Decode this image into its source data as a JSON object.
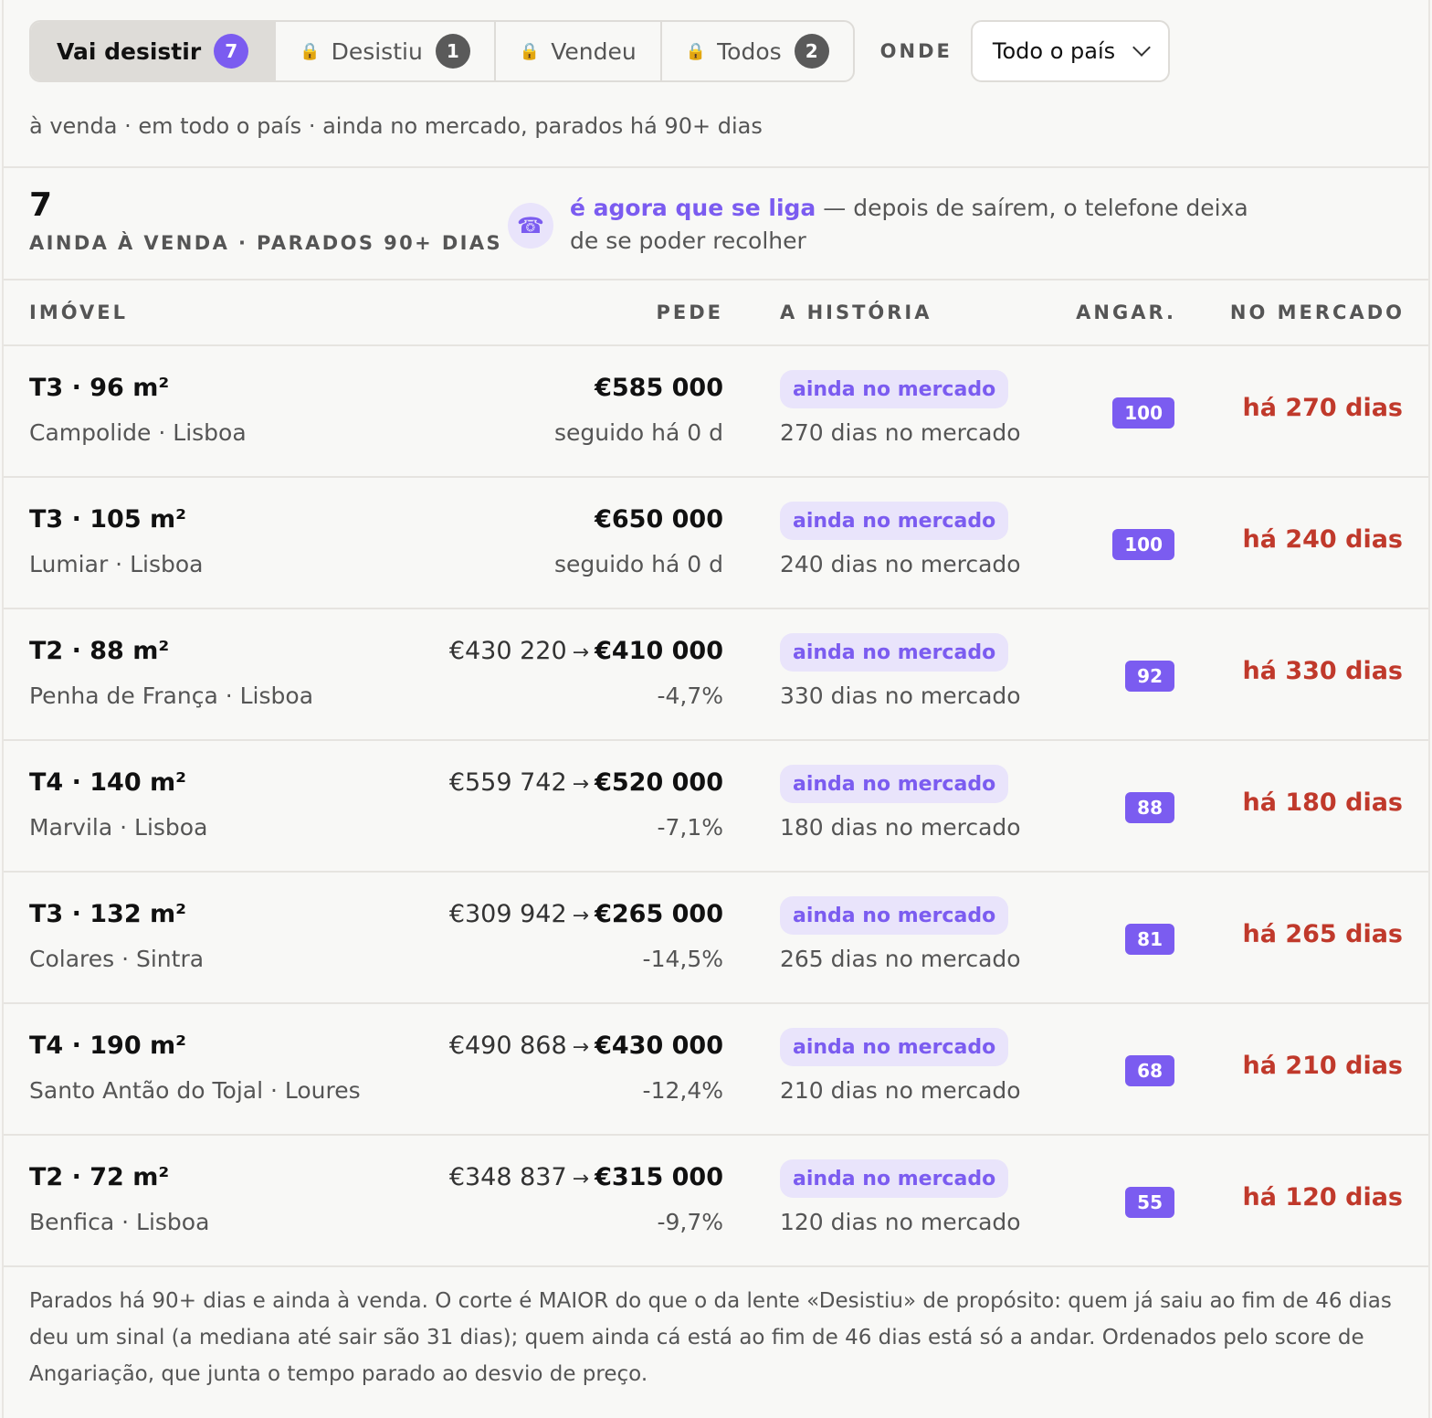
{
  "tabs": [
    {
      "label": "Vai desistir",
      "count": "7",
      "locked": false
    },
    {
      "label": "Desistiu",
      "count": "1",
      "locked": true
    },
    {
      "label": "Vendeu",
      "count": "",
      "locked": true
    },
    {
      "label": "Todos",
      "count": "2",
      "locked": true
    }
  ],
  "filter": {
    "label": "ONDE",
    "value": "Todo o país"
  },
  "subtitle": "à venda · em todo o país · ainda no mercado, parados há 90+ dias",
  "summary": {
    "count": "7",
    "label": "AINDA À VENDA · PARADOS 90+ DIAS",
    "callout_strong": "é agora que se liga",
    "callout_rest": " — depois de saírem, o telefone deixa de se poder recolher"
  },
  "columns": {
    "imovel": "IMÓVEL",
    "pede": "PEDE",
    "historia": "A HISTÓRIA",
    "angar": "ANGAR.",
    "mercado": "NO MERCADO"
  },
  "rows": [
    {
      "title": "T3 · 96 m²",
      "location": "Campolide · Lisboa",
      "old_price": "",
      "price": "€585 000",
      "price_sub": "seguido há 0 d",
      "status": "ainda no mercado",
      "history": "270 dias no mercado",
      "score": "100",
      "since": "há 270 dias"
    },
    {
      "title": "T3 · 105 m²",
      "location": "Lumiar · Lisboa",
      "old_price": "",
      "price": "€650 000",
      "price_sub": "seguido há 0 d",
      "status": "ainda no mercado",
      "history": "240 dias no mercado",
      "score": "100",
      "since": "há 240 dias"
    },
    {
      "title": "T2 · 88 m²",
      "location": "Penha de França · Lisboa",
      "old_price": "€430 220",
      "price": "€410 000",
      "price_sub": "-4,7%",
      "status": "ainda no mercado",
      "history": "330 dias no mercado",
      "score": "92",
      "since": "há 330 dias"
    },
    {
      "title": "T4 · 140 m²",
      "location": "Marvila · Lisboa",
      "old_price": "€559 742",
      "price": "€520 000",
      "price_sub": "-7,1%",
      "status": "ainda no mercado",
      "history": "180 dias no mercado",
      "score": "88",
      "since": "há 180 dias"
    },
    {
      "title": "T3 · 132 m²",
      "location": "Colares · Sintra",
      "old_price": "€309 942",
      "price": "€265 000",
      "price_sub": "-14,5%",
      "status": "ainda no mercado",
      "history": "265 dias no mercado",
      "score": "81",
      "since": "há 265 dias"
    },
    {
      "title": "T4 · 190 m²",
      "location": "Santo Antão do Tojal · Loures",
      "old_price": "€490 868",
      "price": "€430 000",
      "price_sub": "-12,4%",
      "status": "ainda no mercado",
      "history": "210 dias no mercado",
      "score": "68",
      "since": "há 210 dias"
    },
    {
      "title": "T2 · 72 m²",
      "location": "Benfica · Lisboa",
      "old_price": "€348 837",
      "price": "€315 000",
      "price_sub": "-9,7%",
      "status": "ainda no mercado",
      "history": "120 dias no mercado",
      "score": "55",
      "since": "há 120 dias"
    }
  ],
  "footnote": "Parados há 90+ dias e ainda à venda. O corte é MAIOR do que o da lente «Desistiu» de propósito: quem já saiu ao fim de 46 dias deu um sinal (a mediana até sair são 31 dias); quem ainda cá está ao fim de 46 dias está só a andar. Ordenados pelo score de Angariação, que junta o tempo parado ao desvio de preço."
}
